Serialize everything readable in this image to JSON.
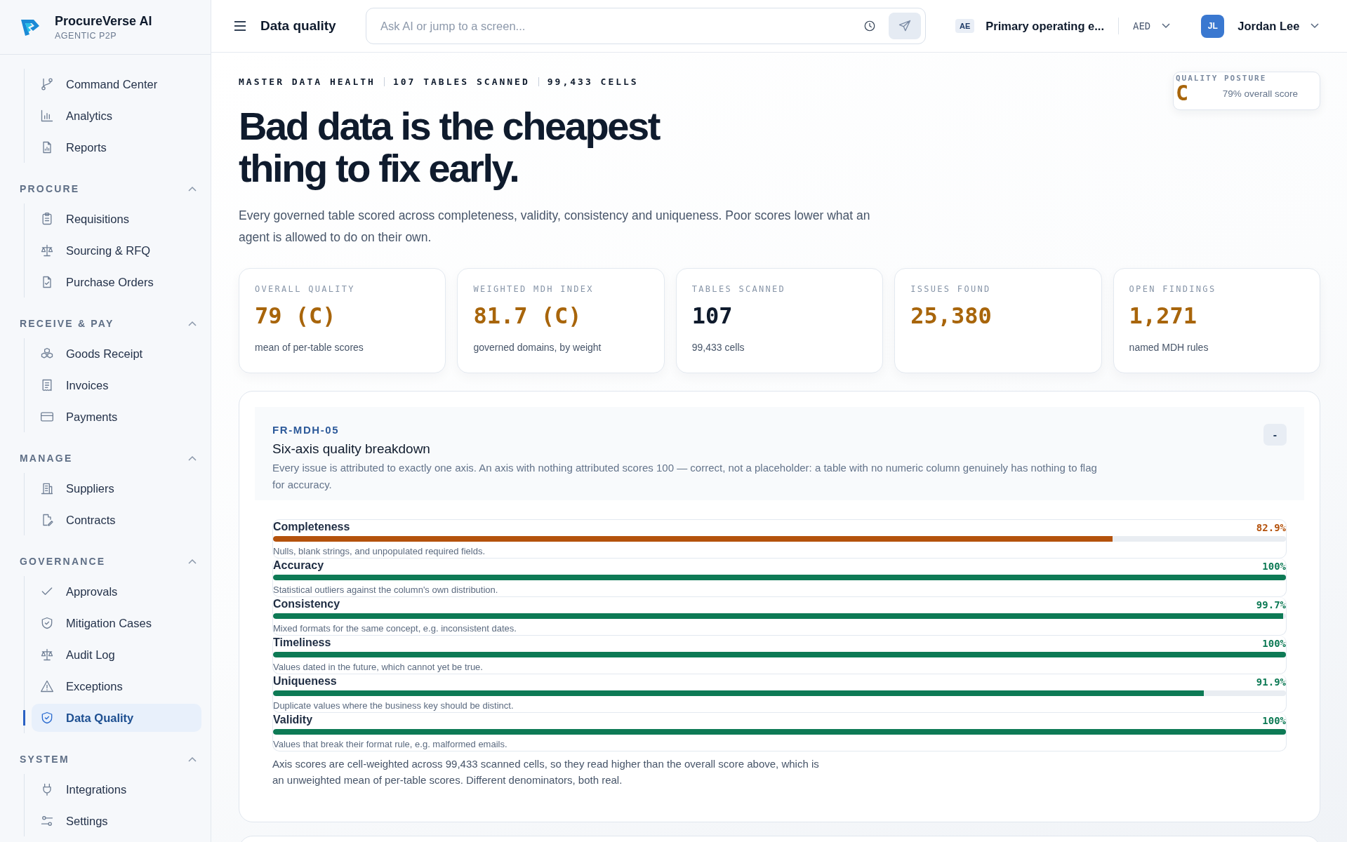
{
  "brand": {
    "name": "ProcureVerse AI",
    "tagline": "AGENTIC P2P"
  },
  "sidebar": {
    "sections": [
      {
        "items": [
          {
            "label": "Command Center",
            "selected": false
          },
          {
            "label": "Analytics",
            "selected": false
          },
          {
            "label": "Reports",
            "selected": false
          }
        ]
      },
      {
        "title": "PROCURE",
        "expanded": true,
        "items": [
          {
            "label": "Requisitions",
            "selected": false
          },
          {
            "label": "Sourcing & RFQ",
            "selected": false
          },
          {
            "label": "Purchase Orders",
            "selected": false
          }
        ]
      },
      {
        "title": "RECEIVE & PAY",
        "expanded": true,
        "items": [
          {
            "label": "Goods Receipt",
            "selected": false
          },
          {
            "label": "Invoices",
            "selected": false
          },
          {
            "label": "Payments",
            "selected": false
          }
        ]
      },
      {
        "title": "MANAGE",
        "expanded": true,
        "items": [
          {
            "label": "Suppliers",
            "selected": false
          },
          {
            "label": "Contracts",
            "selected": false
          }
        ]
      },
      {
        "title": "GOVERNANCE",
        "expanded": true,
        "items": [
          {
            "label": "Approvals",
            "selected": false
          },
          {
            "label": "Mitigation Cases",
            "selected": false
          },
          {
            "label": "Audit Log",
            "selected": false
          },
          {
            "label": "Exceptions",
            "selected": false
          },
          {
            "label": "Data Quality",
            "selected": true
          }
        ]
      },
      {
        "title": "SYSTEM",
        "expanded": true,
        "items": [
          {
            "label": "Integrations",
            "selected": false
          },
          {
            "label": "Settings",
            "selected": false
          }
        ]
      }
    ]
  },
  "header": {
    "title": "Data quality",
    "search": {
      "placeholder": "Ask AI or jump to a screen..."
    },
    "entity_badge": "AE",
    "entity": "Primary operating e...",
    "currency": "AED",
    "user": {
      "initials": "JL",
      "name": "Jordan Lee"
    }
  },
  "hero": {
    "stats": [
      "MASTER DATA HEALTH",
      "107 TABLES SCANNED",
      "99,433 CELLS"
    ],
    "heading": "Bad data is the cheapest thing to fix early.",
    "description": "Every governed table scored across completeness, validity, consistency and uniqueness. Poor scores lower what an agent is allowed to do on their own.",
    "posture": {
      "label": "QUALITY POSTURE",
      "grade": "C",
      "score": "79% overall score"
    }
  },
  "metrics": [
    {
      "label": "OVERALL QUALITY",
      "value": "79 (C)",
      "color": "#a8650b",
      "note": "mean of per-table scores"
    },
    {
      "label": "WEIGHTED MDH INDEX",
      "value": "81.7 (C)",
      "color": "#a8650b",
      "note": "governed domains, by weight"
    },
    {
      "label": "TABLES SCANNED",
      "value": "107",
      "color": "#0f1b2d",
      "note": "99,433 cells"
    },
    {
      "label": "ISSUES FOUND",
      "value": "25,380",
      "color": "#a8650b"
    },
    {
      "label": "OPEN FINDINGS",
      "value": "1,271",
      "color": "#a8650b",
      "note": "named MDH rules"
    }
  ],
  "breakdown": {
    "code": "FR-MDH-05",
    "title": "Six-axis quality breakdown",
    "description": "Every issue is attributed to exactly one axis. An axis with nothing attributed scores 100 — correct, not a placeholder: a table with no numeric column genuinely has nothing to flag for accuracy.",
    "collapse_button": "-",
    "axes": [
      {
        "name": "Completeness",
        "reading": "82.9%",
        "level": 0.829,
        "color": "#b4520c",
        "description": "Nulls, blank strings, and unpopulated required fields."
      },
      {
        "name": "Accuracy",
        "reading": "100%",
        "level": 1,
        "color": "#0d7a55",
        "description": "Statistical outliers against the column's own distribution."
      },
      {
        "name": "Consistency",
        "reading": "99.7%",
        "level": 0.997,
        "color": "#0d7a55",
        "description": "Mixed formats for the same concept, e.g. inconsistent dates."
      },
      {
        "name": "Timeliness",
        "reading": "100%",
        "level": 1,
        "color": "#0d7a55",
        "description": "Values dated in the future, which cannot yet be true."
      },
      {
        "name": "Uniqueness",
        "reading": "91.9%",
        "level": 0.919,
        "color": "#0d7a55",
        "description": "Duplicate values where the business key should be distinct."
      },
      {
        "name": "Validity",
        "reading": "100%",
        "level": 1,
        "color": "#0d7a55",
        "description": "Values that break their format rule, e.g. malformed emails."
      }
    ],
    "footnote": "Axis scores are cell-weighted across 99,433 scanned cells, so they read higher than the overall score above, which is an unweighted mean of per-table scores. Different denominators, both real."
  }
}
